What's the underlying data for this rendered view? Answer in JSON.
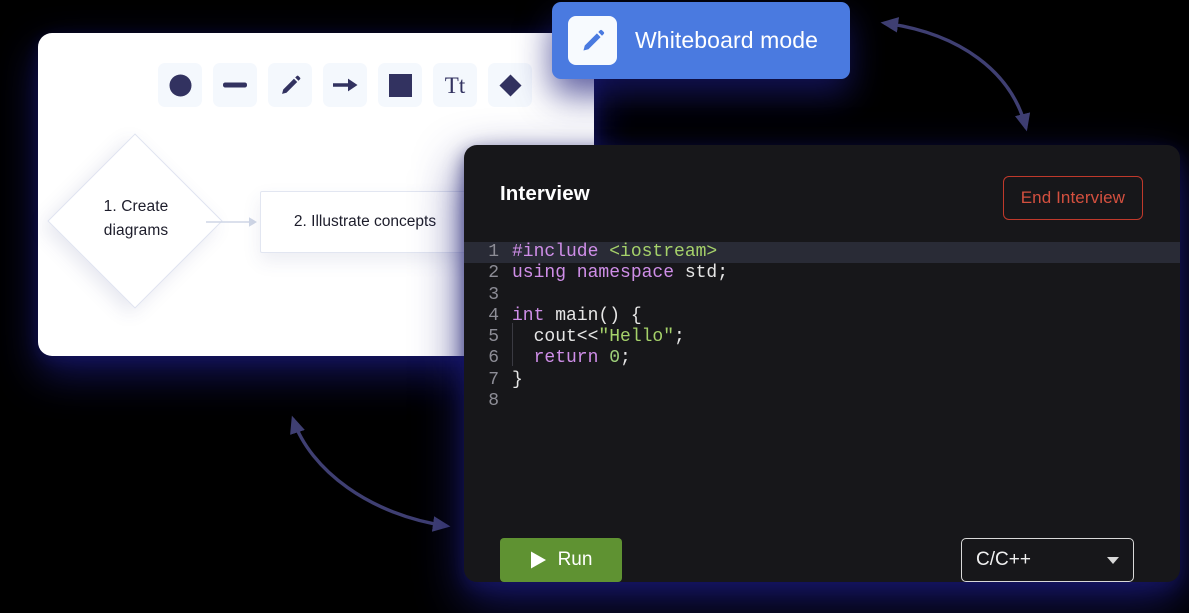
{
  "colors": {
    "page_background": "#000000",
    "badge_blue": "#4a7ae0",
    "editor_background": "#17171a",
    "run_green": "#5f9232",
    "end_red": "#d4503f",
    "glow_shadow": "#1a1a78",
    "arrow_navy": "#3f3f72",
    "toolbar_icon": "#323260"
  },
  "whiteboard_badge": {
    "label": "Whiteboard mode",
    "icon": "pencil-icon"
  },
  "whiteboard": {
    "toolbar": [
      {
        "name": "circle-tool",
        "icon": "circle-icon"
      },
      {
        "name": "line-tool",
        "icon": "line-icon"
      },
      {
        "name": "pencil-tool",
        "icon": "pencil-icon"
      },
      {
        "name": "arrow-tool",
        "icon": "arrow-icon"
      },
      {
        "name": "square-tool",
        "icon": "square-icon"
      },
      {
        "name": "text-tool",
        "icon": "text-icon",
        "glyph": "Tt"
      },
      {
        "name": "diamond-tool",
        "icon": "diamond-icon"
      }
    ],
    "nodes": {
      "diamond_label": "1. Create\ndiagrams",
      "rect_label": "2. Illustrate concepts"
    }
  },
  "editor": {
    "title": "Interview",
    "end_button": "End Interview",
    "run_button": "Run",
    "run_icon": "play-icon",
    "language": "C/C++",
    "active_line": 1,
    "code_lines": [
      {
        "num": "1",
        "indented": false,
        "tokens": [
          {
            "t": "#include ",
            "c": "k"
          },
          {
            "t": "<iostream>",
            "c": "s"
          }
        ]
      },
      {
        "num": "2",
        "indented": false,
        "tokens": [
          {
            "t": "using namespace ",
            "c": "k"
          },
          {
            "t": "std;",
            "c": "w"
          }
        ]
      },
      {
        "num": "3",
        "indented": false,
        "tokens": []
      },
      {
        "num": "4",
        "indented": false,
        "tokens": [
          {
            "t": "int ",
            "c": "k"
          },
          {
            "t": "main() {",
            "c": "w"
          }
        ]
      },
      {
        "num": "5",
        "indented": true,
        "tokens": [
          {
            "t": "  cout<<",
            "c": "w"
          },
          {
            "t": "\"Hello\"",
            "c": "s"
          },
          {
            "t": ";",
            "c": "w"
          }
        ]
      },
      {
        "num": "6",
        "indented": true,
        "tokens": [
          {
            "t": "  return ",
            "c": "k"
          },
          {
            "t": "0",
            "c": "n"
          },
          {
            "t": ";",
            "c": "w"
          }
        ]
      },
      {
        "num": "7",
        "indented": false,
        "tokens": [
          {
            "t": "}",
            "c": "w"
          }
        ]
      },
      {
        "num": "8",
        "indented": false,
        "tokens": []
      }
    ]
  }
}
